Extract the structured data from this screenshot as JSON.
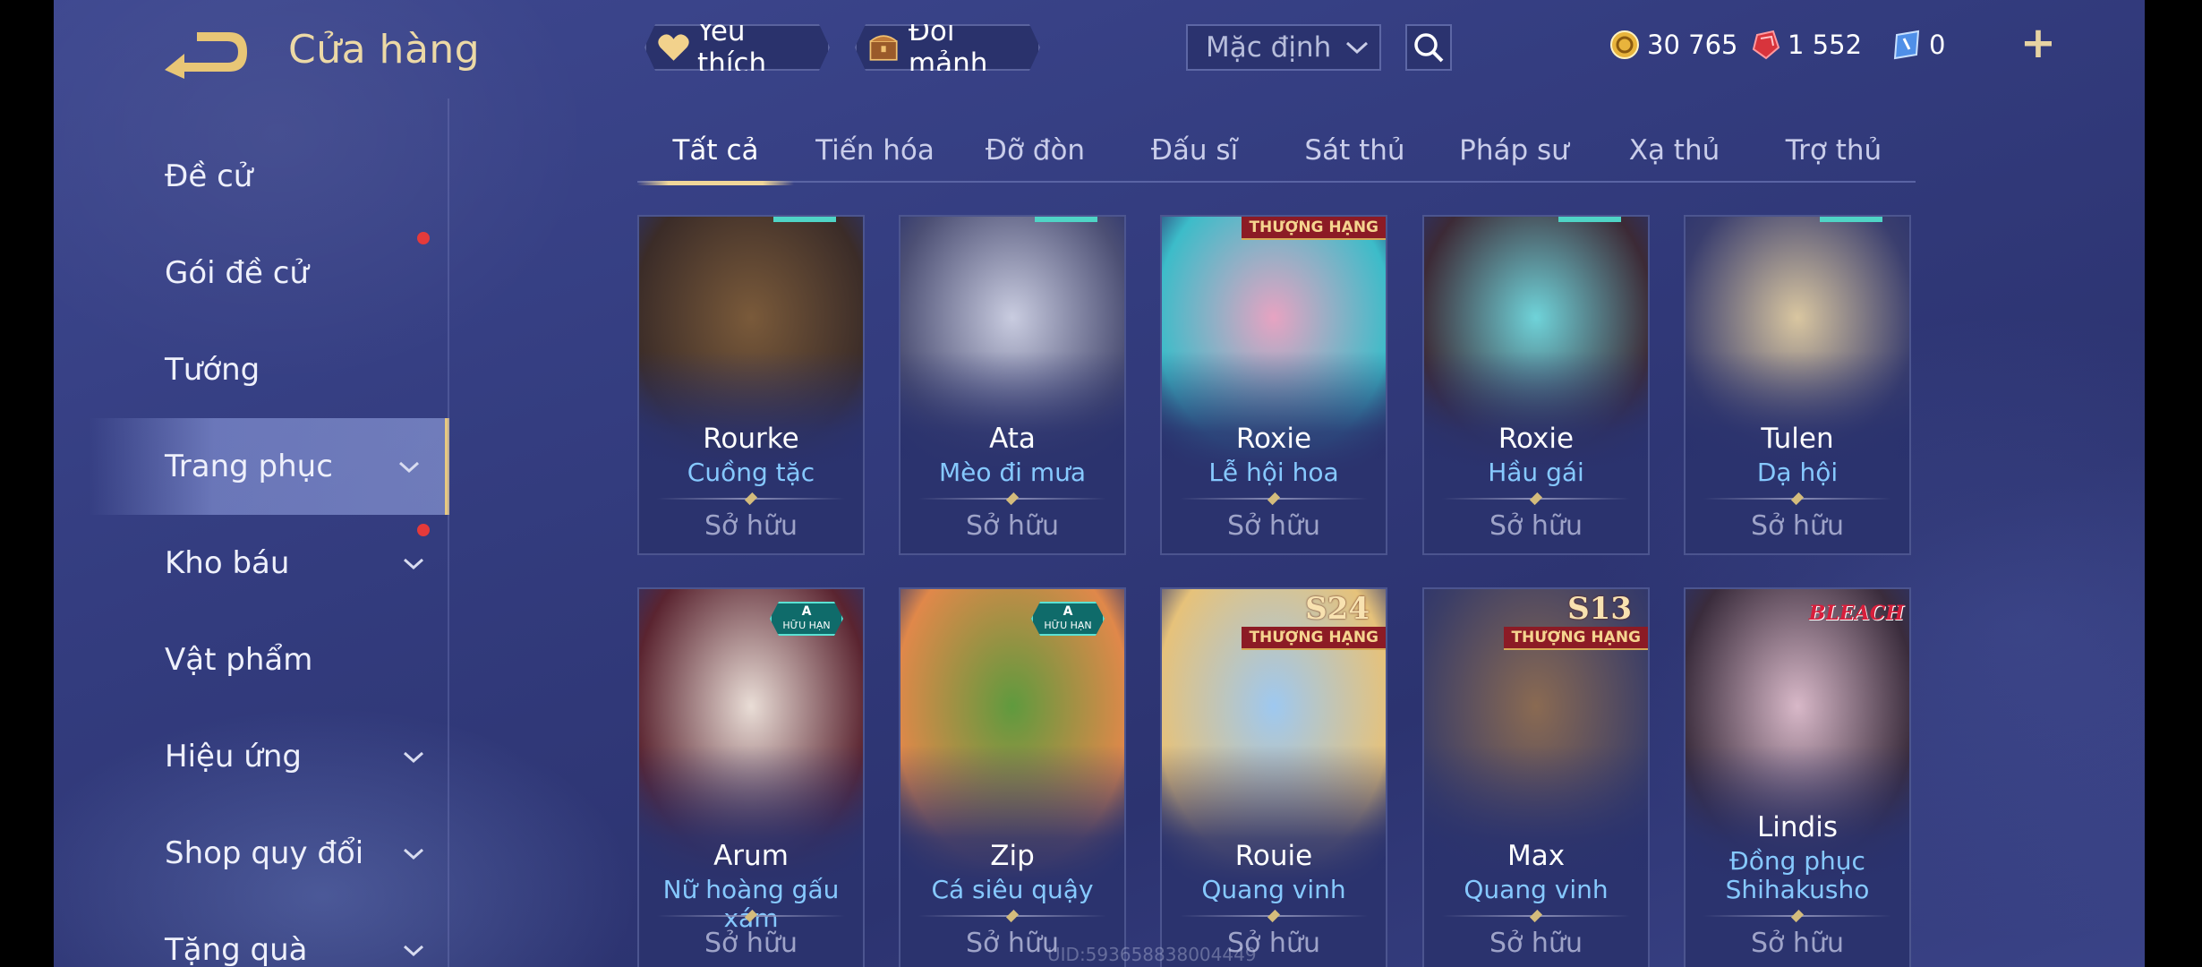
{
  "header": {
    "title": "Cửa hàng",
    "favorites_label": "Yêu thích",
    "exchange_label": "Đổi mảnh",
    "sort_value": "Mặc định"
  },
  "currency": {
    "gold": "30 765",
    "ruby": "1 552",
    "voucher": "0"
  },
  "sidebar": {
    "items": [
      {
        "label": "Đề cử"
      },
      {
        "label": "Gói đề cử"
      },
      {
        "label": "Tướng"
      },
      {
        "label": "Trang phục"
      },
      {
        "label": "Kho báu"
      },
      {
        "label": "Vật phẩm"
      },
      {
        "label": "Hiệu ứng"
      },
      {
        "label": "Shop quy đổi"
      },
      {
        "label": "Tặng quà"
      }
    ]
  },
  "tabs": [
    "Tất cả",
    "Tiến hóa",
    "Đỡ đòn",
    "Đấu sĩ",
    "Sát thủ",
    "Pháp sư",
    "Xạ thủ",
    "Trợ thủ"
  ],
  "badges": {
    "rank": "THƯỢNG HẠNG",
    "limited_top": "A",
    "limited_bottom": "HỮU HẠN",
    "season_24": "S24",
    "season_13": "S13",
    "bleach": "BLEACH"
  },
  "cards": [
    {
      "hero": "Rourke",
      "skin": "Cuồng tặc",
      "status": "Sở hữu",
      "colors": [
        "#7a5a3a",
        "#3b2c28"
      ]
    },
    {
      "hero": "Ata",
      "skin": "Mèo đi mưa",
      "status": "Sở hữu",
      "colors": [
        "#c9cce0",
        "#4c4f74"
      ]
    },
    {
      "hero": "Roxie",
      "skin": "Lễ hội hoa",
      "status": "Sở hữu",
      "colors": [
        "#e7a3c2",
        "#3cbcc9"
      ]
    },
    {
      "hero": "Roxie",
      "skin": "Hầu gái",
      "status": "Sở hữu",
      "colors": [
        "#6fd3d9",
        "#3c2a36"
      ]
    },
    {
      "hero": "Tulen",
      "skin": "Dạ hội",
      "status": "Sở hữu",
      "colors": [
        "#d9c6a0",
        "#3a3e6e"
      ]
    },
    {
      "hero": "Arum",
      "skin": "Nữ hoàng gấu xám",
      "status": "Sở hữu",
      "colors": [
        "#e9ddd6",
        "#5a2430"
      ]
    },
    {
      "hero": "Zip",
      "skin": "Cá siêu quậy",
      "status": "Sở hữu",
      "colors": [
        "#5f9a3e",
        "#e0884a"
      ]
    },
    {
      "hero": "Rouie",
      "skin": "Quang vinh",
      "status": "Sở hữu",
      "colors": [
        "#9ec8f0",
        "#e6c27a"
      ]
    },
    {
      "hero": "Max",
      "skin": "Quang vinh",
      "status": "Sở hữu",
      "colors": [
        "#8a6a52",
        "#3c3e66"
      ]
    },
    {
      "hero": "Lindis",
      "skin": "Đồng phục Shihakusho",
      "skin_line1": "Đồng phục",
      "skin_line2": "Shihakusho",
      "status": "Sở hữu",
      "colors": [
        "#d8b8c8",
        "#3a2c3c"
      ]
    }
  ],
  "uid": "UID:593658838004449"
}
